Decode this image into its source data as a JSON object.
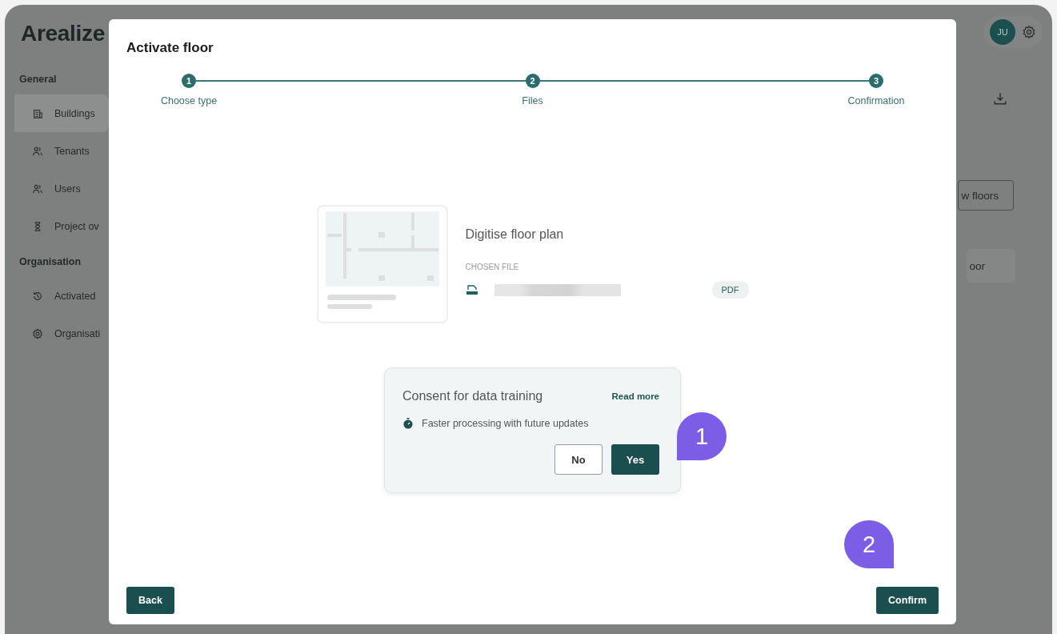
{
  "app": {
    "logo": "Arealize",
    "sidebar": [
      {
        "heading": "General",
        "items": [
          {
            "label": "Buildings",
            "kind": "building",
            "selected": true
          },
          {
            "label": "Tenants",
            "kind": "people",
            "selected": false
          },
          {
            "label": "Users",
            "kind": "people",
            "selected": false
          },
          {
            "label": "Project ov",
            "kind": "hourglass",
            "selected": false
          }
        ]
      },
      {
        "heading": "Organisation",
        "items": [
          {
            "label": "Activated",
            "kind": "history",
            "selected": false
          },
          {
            "label": "Organisati",
            "kind": "gear",
            "selected": false
          }
        ]
      }
    ],
    "avatar": "JU",
    "main_buttons": [
      {
        "label": "w floors",
        "kind": "outline"
      },
      {
        "label": "oor",
        "kind": "filled"
      }
    ]
  },
  "dialog": {
    "title": "Activate floor",
    "steps": [
      {
        "number": "1",
        "label": "Choose type"
      },
      {
        "number": "2",
        "label": "Files"
      },
      {
        "number": "3",
        "label": "Confirmation"
      }
    ],
    "option": {
      "title": "Digitise floor plan",
      "file_label": "CHOSEN FILE",
      "file_type": "PDF"
    },
    "consent": {
      "title": "Consent for data training",
      "link": "Read more",
      "note": "Faster processing with future updates",
      "buttons": [
        {
          "label": "No",
          "kind": "outline"
        },
        {
          "label": "Yes",
          "kind": "filled"
        }
      ]
    },
    "back": "Back",
    "confirm": "Confirm"
  },
  "annotations": [
    {
      "label": "1"
    },
    {
      "label": "2"
    }
  ]
}
